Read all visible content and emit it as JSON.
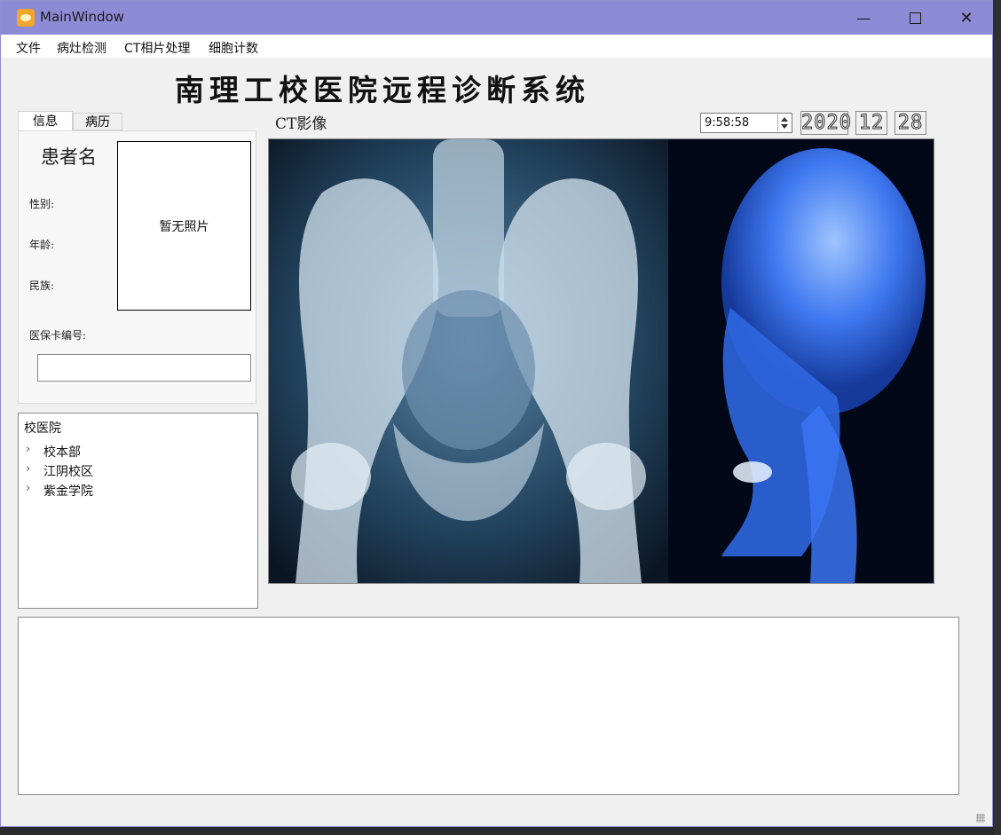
{
  "window": {
    "title": "MainWindow"
  },
  "menu": [
    "文件",
    "病灶检测",
    "CT相片处理",
    "细胞计数"
  ],
  "heading": "南理工校医院远程诊断系统",
  "tabs": [
    {
      "label": "信息",
      "active": true
    },
    {
      "label": "病历",
      "active": false
    }
  ],
  "patient": {
    "name": "患者名",
    "gender_label": "性别:",
    "age_label": "年龄:",
    "ethnicity_label": "民族:",
    "photo_placeholder": "暂无照片",
    "insurance_label": "医保卡编号:",
    "insurance_value": ""
  },
  "tree": {
    "root": "校医院",
    "items": [
      "校本部",
      "江阴校区",
      "紫金学院"
    ]
  },
  "ct": {
    "label": "CT影像"
  },
  "clock": {
    "time": "9:58:58",
    "year": "2020",
    "month": "12",
    "day": "28"
  },
  "colors": {
    "titlebar": "#8e8bd6",
    "xray_blue": "#3f7cff"
  }
}
